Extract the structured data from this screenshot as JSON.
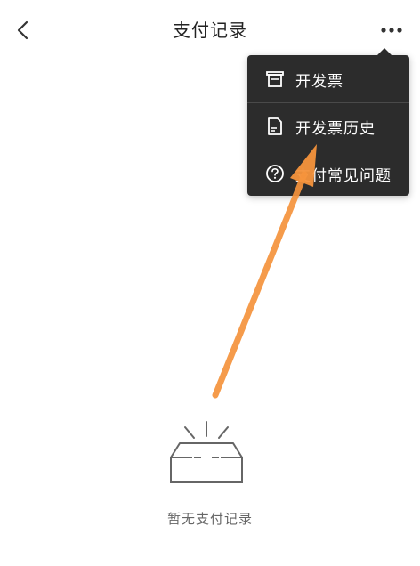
{
  "header": {
    "title": "支付记录",
    "back_icon": "chevron-left-icon",
    "more_icon": "more-horizontal-icon"
  },
  "menu": {
    "items": [
      {
        "label": "开发票",
        "icon": "printer-icon"
      },
      {
        "label": "开发票历史",
        "icon": "document-icon"
      },
      {
        "label": "支付常见问题",
        "icon": "help-circle-icon"
      }
    ]
  },
  "empty_state": {
    "text": "暂无支付记录",
    "icon": "empty-box-icon"
  },
  "colors": {
    "menu_background": "#2c2c2c",
    "annotation_arrow": "#f5933c"
  }
}
